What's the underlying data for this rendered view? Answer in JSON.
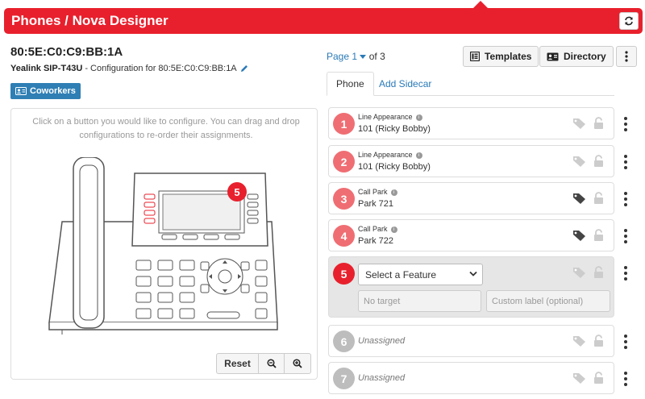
{
  "header": {
    "title": "Phones  /  Nova Designer",
    "refresh_icon": "refresh-icon"
  },
  "device": {
    "mac": "80:5E:C0:C9:BB:1A",
    "model": "Yealink SIP-T43U",
    "config_text": " - Configuration for 80:5E:C0:C9:BB:1A",
    "coworkers_label": "Coworkers"
  },
  "left": {
    "help_text": "Click on a button you would like to configure. You can drag and drop configurations to re-order their assignments.",
    "selected_key_badge": "5",
    "reset_label": "Reset"
  },
  "paging": {
    "page_label": "Page 1",
    "of_label": "of 3"
  },
  "toolbar": {
    "templates_label": "Templates",
    "directory_label": "Directory"
  },
  "tabs": [
    {
      "label": "Phone"
    },
    {
      "label": "Add Sidecar"
    }
  ],
  "rows": [
    {
      "num": "1",
      "type": "Line Appearance",
      "target": "101 (Ricky Bobby)",
      "tag_active": false
    },
    {
      "num": "2",
      "type": "Line Appearance",
      "target": "101 (Ricky Bobby)",
      "tag_active": false
    },
    {
      "num": "3",
      "type": "Call Park",
      "target": "Park 721",
      "tag_active": true
    },
    {
      "num": "4",
      "type": "Call Park",
      "target": "Park 722",
      "tag_active": true
    }
  ],
  "editing_row": {
    "num": "5",
    "select_value": "Select a Feature",
    "target_placeholder": "No target",
    "label_placeholder": "Custom label (optional)"
  },
  "unassigned_rows": [
    {
      "num": "6",
      "label": "Unassigned"
    },
    {
      "num": "7",
      "label": "Unassigned"
    }
  ],
  "colors": {
    "brand_red": "#e8202d",
    "assigned_badge": "#ef6e73",
    "unassigned_badge": "#bdbdbd",
    "link": "#2a7ab8"
  }
}
